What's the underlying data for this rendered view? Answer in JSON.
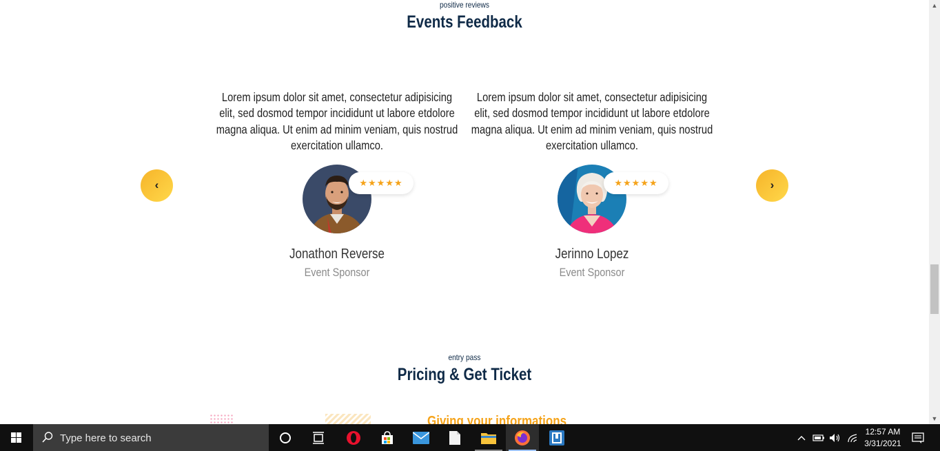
{
  "feedback_section": {
    "kicker": "positive reviews",
    "title": "Events Feedback",
    "testimonials": [
      {
        "quote": "Lorem ipsum dolor sit amet, consectetur adipisicing elit, sed dosmod tempor incididunt ut labore etdolore magna aliqua. Ut enim ad minim veniam, quis nostrud exercitation ullamco.",
        "rating": "★★★★★",
        "name": "Jonathon Reverse",
        "role": "Event Sponsor"
      },
      {
        "quote": "Lorem ipsum dolor sit amet, consectetur adipisicing elit, sed dosmod tempor incididunt ut labore etdolore magna aliqua. Ut enim ad minim veniam, quis nostrud exercitation ullamco.",
        "rating": "★★★★★",
        "name": "Jerinno Lopez",
        "role": "Event Sponsor"
      }
    ],
    "prev_label": "‹",
    "next_label": "›"
  },
  "pricing_section": {
    "kicker": "entry pass",
    "title": "Pricing & Get Ticket",
    "info_heading": "Giving your informations"
  },
  "taskbar": {
    "search_placeholder": "Type here to search",
    "time": "12:57 AM",
    "date": "3/31/2021"
  },
  "colors": {
    "heading": "#0f2a47",
    "accent": "#f5a31a",
    "button_gradient_start": "#f6b42a",
    "button_gradient_end": "#ffd84a",
    "taskbar": "#101010"
  }
}
